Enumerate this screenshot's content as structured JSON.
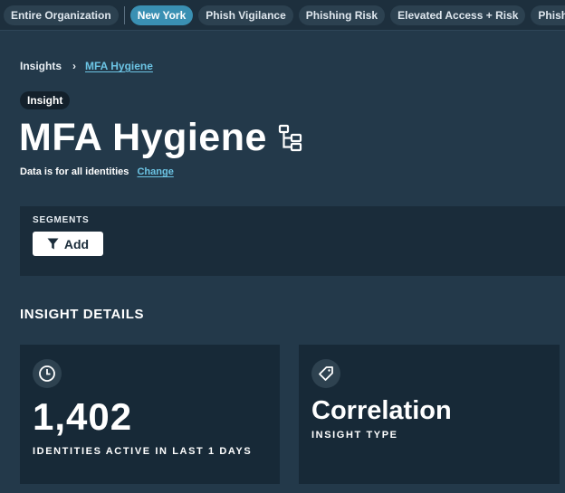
{
  "segment_bar": {
    "pills": [
      {
        "label": "Entire Organization",
        "active": false
      },
      {
        "label": "New York",
        "active": true
      },
      {
        "label": "Phish Vigilance",
        "active": false
      },
      {
        "label": "Phishing Risk",
        "active": false
      },
      {
        "label": "Elevated Access + Risk",
        "active": false
      },
      {
        "label": "Phish Clicked",
        "active": false
      }
    ]
  },
  "breadcrumb": {
    "root": "Insights",
    "separator": "›",
    "current": "MFA Hygiene"
  },
  "badge": "Insight",
  "title": "MFA Hygiene",
  "scope": {
    "text": "Data is for all identities",
    "change_link": "Change"
  },
  "segments": {
    "label": "SEGMENTS",
    "add_button": "Add"
  },
  "details": {
    "heading": "INSIGHT DETAILS",
    "cards": [
      {
        "icon": "clock-icon",
        "value": "1,402",
        "caption": "IDENTITIES ACTIVE IN LAST 1 DAYS"
      },
      {
        "icon": "tag-icon",
        "value": "Correlation",
        "caption": "INSIGHT TYPE"
      }
    ]
  },
  "colors": {
    "background": "#23394a",
    "topbar": "#1d2f3d",
    "active_pill": "#3a90b3",
    "link": "#6cc4e4",
    "card": "#172937"
  }
}
